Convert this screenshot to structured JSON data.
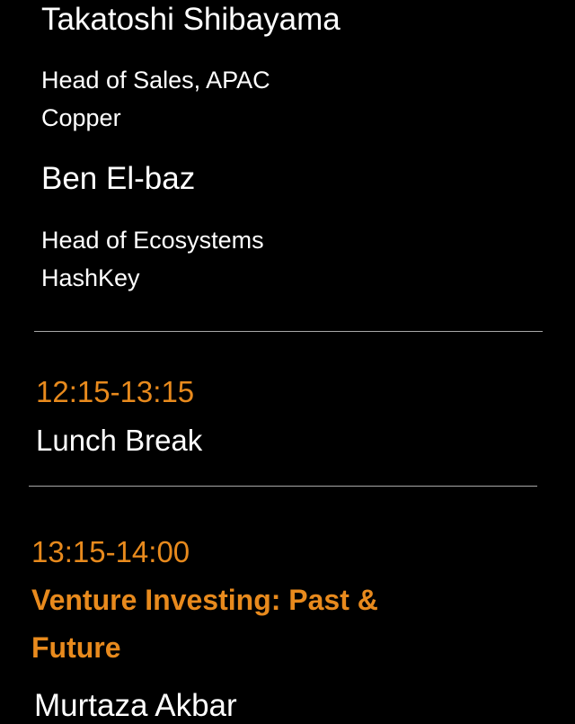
{
  "speakers_top": [
    {
      "name": "Takatoshi Shibayama",
      "role": "Head of Sales, APAC",
      "company": "Copper"
    },
    {
      "name": "Ben El-baz",
      "role": "Head of Ecosystems",
      "company": "HashKey"
    }
  ],
  "sessions": [
    {
      "time": "12:15-13:15",
      "title": "Lunch Break"
    },
    {
      "time": "13:15-14:00",
      "title": "Venture Investing: Past & Future",
      "speaker": "Murtaza Akbar"
    }
  ],
  "colors": {
    "background": "#000000",
    "accent": "#e88a1d",
    "text": "#ffffff",
    "divider": "#a7a7a7"
  }
}
